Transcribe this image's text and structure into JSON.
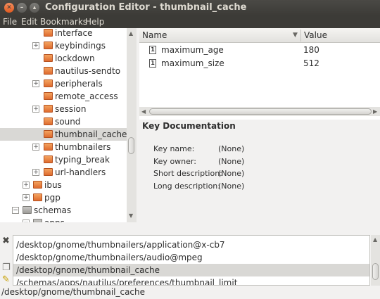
{
  "window": {
    "title": "Configuration Editor - thumbnail_cache"
  },
  "menubar": [
    "File",
    "Edit",
    "Bookmarks",
    "Help"
  ],
  "tree": {
    "items": [
      {
        "label": "interface",
        "expander": "",
        "folder": "orange"
      },
      {
        "label": "keybindings",
        "expander": "+",
        "folder": "orange"
      },
      {
        "label": "lockdown",
        "expander": "",
        "folder": "orange"
      },
      {
        "label": "nautilus-sendto",
        "expander": "",
        "folder": "orange"
      },
      {
        "label": "peripherals",
        "expander": "+",
        "folder": "orange"
      },
      {
        "label": "remote_access",
        "expander": "",
        "folder": "orange"
      },
      {
        "label": "session",
        "expander": "+",
        "folder": "orange"
      },
      {
        "label": "sound",
        "expander": "",
        "folder": "orange"
      },
      {
        "label": "thumbnail_cache",
        "expander": "",
        "folder": "orange",
        "selected": true
      },
      {
        "label": "thumbnailers",
        "expander": "+",
        "folder": "orange"
      },
      {
        "label": "typing_break",
        "expander": "",
        "folder": "orange"
      },
      {
        "label": "url-handlers",
        "expander": "+",
        "folder": "orange"
      },
      {
        "label": "ibus",
        "expander": "+",
        "folder": "orange"
      },
      {
        "label": "pgp",
        "expander": "+",
        "folder": "orange"
      },
      {
        "label": "schemas",
        "expander": "−",
        "folder": "grey"
      },
      {
        "label": "apps",
        "expander": "−",
        "folder": "grey"
      }
    ]
  },
  "keys": {
    "columns": {
      "name": "Name",
      "value": "Value"
    },
    "rows": [
      {
        "icon": "integer-icon",
        "icon_text": "1",
        "name": "maximum_age",
        "value": "180"
      },
      {
        "icon": "integer-icon",
        "icon_text": "1",
        "name": "maximum_size",
        "value": "512"
      }
    ]
  },
  "doc": {
    "title": "Key Documentation",
    "fields": [
      {
        "label": "Key name:",
        "value": "(None)"
      },
      {
        "label": "Key owner:",
        "value": "(None)"
      },
      {
        "label": "Short description:",
        "value": "(None)"
      },
      {
        "label": "Long description:",
        "value": "(None)"
      }
    ]
  },
  "search_results": [
    "/desktop/gnome/thumbnailers/application@x-cb7",
    "/desktop/gnome/thumbnailers/audio@mpeg",
    "/desktop/gnome/thumbnail_cache",
    "/schemas/apps/nautilus/preferences/thumbnail_limit"
  ],
  "selected_result": 2,
  "status": "/desktop/gnome/thumbnail_cache",
  "colors": {
    "titlebar": "#3c3b37",
    "folder": "#de6b2f",
    "selection": "#d9d8d5",
    "close_button": "#e05a1f"
  }
}
